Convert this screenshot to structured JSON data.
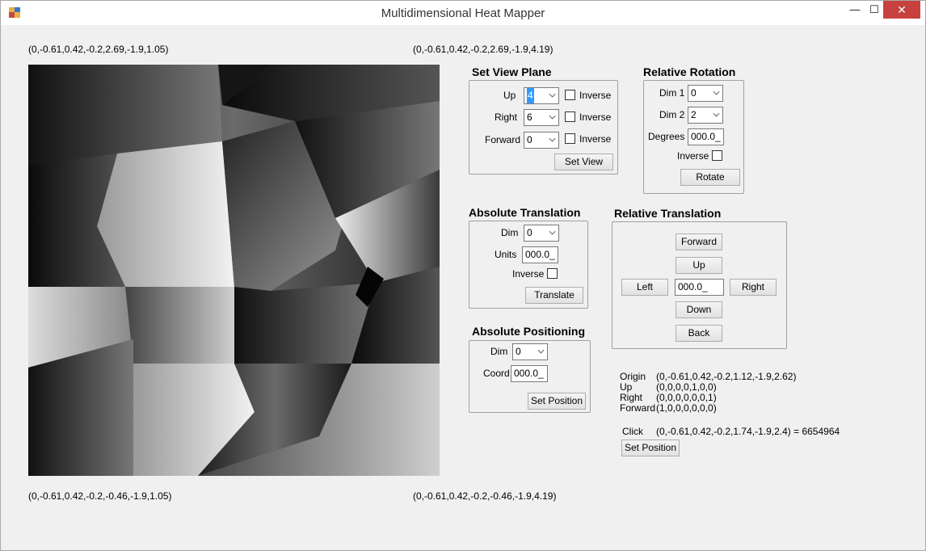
{
  "window": {
    "title": "Multidimensional Heat Mapper",
    "minimize": "—",
    "maximize": "☐",
    "close": "✕"
  },
  "corners": {
    "top_left": "(0,-0.61,0.42,-0.2,2.69,-1.9,1.05)",
    "top_right": "(0,-0.61,0.42,-0.2,2.69,-1.9,4.19)",
    "bottom_left": "(0,-0.61,0.42,-0.2,-0.46,-1.9,1.05)",
    "bottom_right": "(0,-0.61,0.42,-0.2,-0.46,-1.9,4.19)"
  },
  "view_plane": {
    "title": "Set View Plane",
    "up_label": "Up",
    "up_value": "4",
    "right_label": "Right",
    "right_value": "6",
    "forward_label": "Forward",
    "forward_value": "0",
    "inverse_label": "Inverse",
    "button": "Set View"
  },
  "relative_rotation": {
    "title": "Relative Rotation",
    "dim1_label": "Dim 1",
    "dim1_value": "0",
    "dim2_label": "Dim 2",
    "dim2_value": "2",
    "degrees_label": "Degrees",
    "degrees_value": "000.0_",
    "inverse_label": "Inverse",
    "button": "Rotate"
  },
  "absolute_translation": {
    "title": "Absolute Translation",
    "dim_label": "Dim",
    "dim_value": "0",
    "units_label": "Units",
    "units_value": "000.0_",
    "inverse_label": "Inverse",
    "button": "Translate"
  },
  "relative_translation": {
    "title": "Relative Translation",
    "forward": "Forward",
    "up": "Up",
    "left": "Left",
    "right": "Right",
    "down": "Down",
    "back": "Back",
    "value": "000.0_"
  },
  "absolute_positioning": {
    "title": "Absolute Positioning",
    "dim_label": "Dim",
    "dim_value": "0",
    "coord_label": "Coord",
    "coord_value": "000.0_",
    "button": "Set Position"
  },
  "info": {
    "origin_label": "Origin",
    "origin_value": "(0,-0.61,0.42,-0.2,1.12,-1.9,2.62)",
    "up_label": "Up",
    "up_value": "(0,0,0,0,1,0,0)",
    "right_label": "Right",
    "right_value": "(0,0,0,0,0,0,1)",
    "forward_label": "Forward",
    "forward_value": "(1,0,0,0,0,0,0)",
    "click_label": "Click",
    "click_value": "(0,-0.61,0.42,-0.2,1.74,-1.9,2.4) = 6654964",
    "set_position_button": "Set Position"
  }
}
